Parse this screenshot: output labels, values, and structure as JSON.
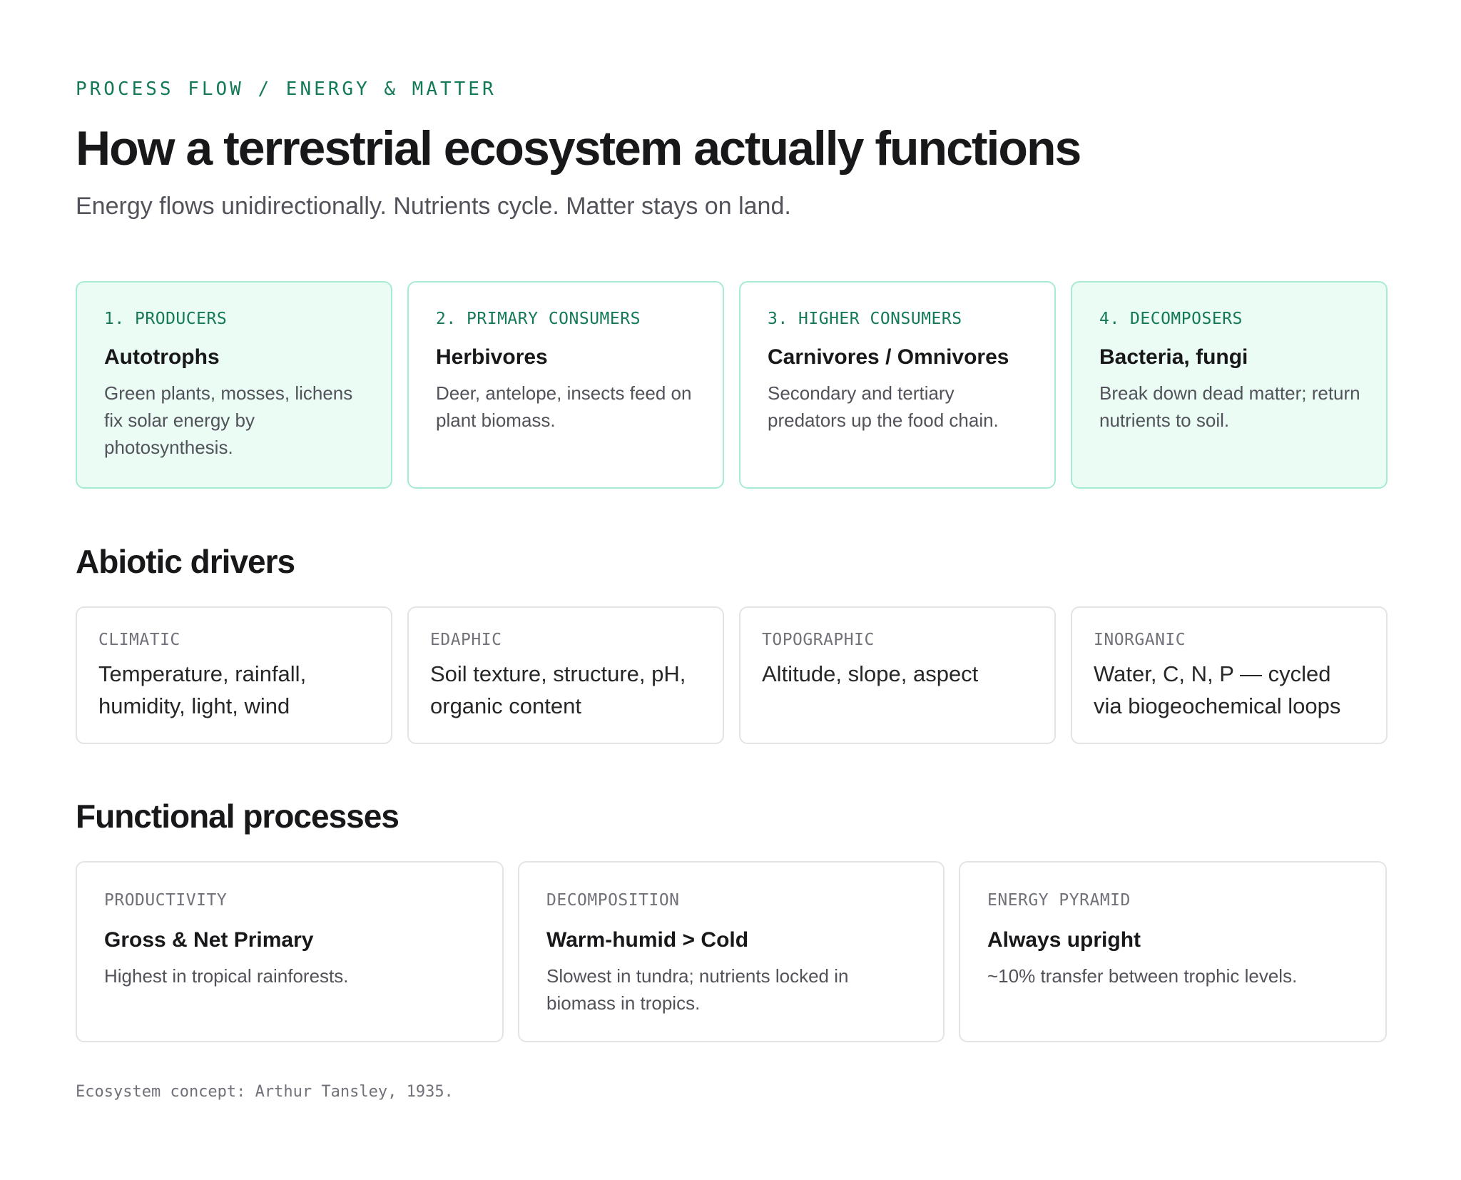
{
  "header": {
    "eyebrow": "PROCESS FLOW / ENERGY & MATTER",
    "title": "How a terrestrial ecosystem actually functions",
    "subtitle": "Energy flows unidirectionally. Nutrients cycle. Matter stays on land."
  },
  "stages": [
    {
      "label": "1. PRODUCERS",
      "title": "Autotrophs",
      "description": "Green plants, mosses, lichens fix solar energy by photosynthesis.",
      "tinted": true
    },
    {
      "label": "2. PRIMARY CONSUMERS",
      "title": "Herbivores",
      "description": "Deer, antelope, insects feed on plant biomass.",
      "tinted": false
    },
    {
      "label": "3. HIGHER CONSUMERS",
      "title": "Carnivores / Omnivores",
      "description": "Secondary and tertiary predators up the food chain.",
      "tinted": false
    },
    {
      "label": "4. DECOMPOSERS",
      "title": "Bacteria, fungi",
      "description": "Break down dead matter; return nutrients to soil.",
      "tinted": true
    }
  ],
  "abiotic": {
    "title": "Abiotic drivers",
    "items": [
      {
        "label": "CLIMATIC",
        "text": "Temperature, rainfall, humidity, light, wind"
      },
      {
        "label": "EDAPHIC",
        "text": "Soil texture, structure, pH, organic content"
      },
      {
        "label": "TOPOGRAPHIC",
        "text": "Altitude, slope, aspect"
      },
      {
        "label": "INORGANIC",
        "text": "Water, C, N, P — cycled via biogeochemical loops"
      }
    ]
  },
  "functional": {
    "title": "Functional processes",
    "items": [
      {
        "label": "PRODUCTIVITY",
        "title": "Gross & Net Primary",
        "description": "Highest in tropical rainforests."
      },
      {
        "label": "DECOMPOSITION",
        "title": "Warm-humid > Cold",
        "description": "Slowest in tundra; nutrients locked in biomass in tropics."
      },
      {
        "label": "ENERGY PYRAMID",
        "title": "Always upright",
        "description": "~10% transfer between trophic levels."
      }
    ]
  },
  "footnote": "Ecosystem concept: Arthur Tansley, 1935.",
  "colors": {
    "accent": "#137a55",
    "card_border_accent": "#a7ecd0",
    "card_tint": "#ebfcf4",
    "card_border_neutral": "#e4e4e7"
  }
}
